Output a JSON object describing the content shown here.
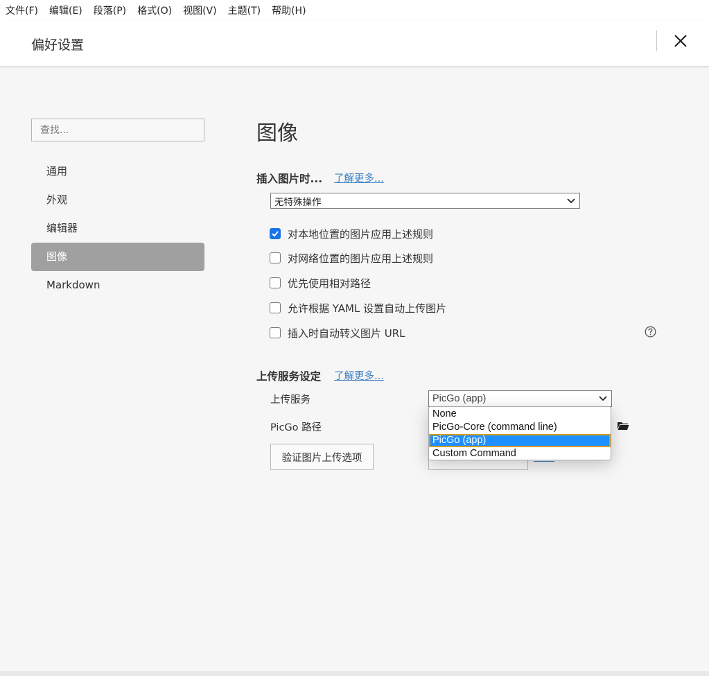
{
  "menubar": {
    "items": [
      "文件(F)",
      "编辑(E)",
      "段落(P)",
      "格式(O)",
      "视图(V)",
      "主题(T)",
      "帮助(H)"
    ]
  },
  "header": {
    "title": "偏好设置",
    "close_icon": "close-icon"
  },
  "sidebar": {
    "search_placeholder": "查找...",
    "items": [
      {
        "label": "通用",
        "active": false
      },
      {
        "label": "外观",
        "active": false
      },
      {
        "label": "编辑器",
        "active": false
      },
      {
        "label": "图像",
        "active": true
      },
      {
        "label": "Markdown",
        "active": false
      }
    ]
  },
  "main": {
    "title": "图像",
    "insert_section": {
      "title": "插入图片时...",
      "learn_more": "了解更多...",
      "action_select": "无特殊操作"
    },
    "checkboxes": [
      {
        "label": "对本地位置的图片应用上述规则",
        "checked": true
      },
      {
        "label": "对网络位置的图片应用上述规则",
        "checked": false
      },
      {
        "label": "优先使用相对路径",
        "checked": false
      },
      {
        "label": "允许根据 YAML 设置自动上传图片",
        "checked": false
      },
      {
        "label": "插入时自动转义图片 URL",
        "checked": false
      }
    ],
    "help_icon": "question-circle-icon",
    "upload_section": {
      "title": "上传服务设定",
      "learn_more": "了解更多...",
      "service_label": "上传服务",
      "service_value": "PicGo (app)",
      "path_label": "PicGo 路径",
      "verify_button": "验证图片上传选项",
      "folder_icon": "folder-icon",
      "dropdown_options": [
        "None",
        "PicGo-Core (command line)",
        "PicGo (app)",
        "Custom Command"
      ],
      "dropdown_selected": "PicGo (app)"
    }
  },
  "colors": {
    "accent": "#1a73e8",
    "link": "#4183c4",
    "active_nav_bg": "#a0a0a0",
    "dropdown_selected_bg": "#1e90ff",
    "dropdown_selected_outline": "#d49b1e"
  }
}
